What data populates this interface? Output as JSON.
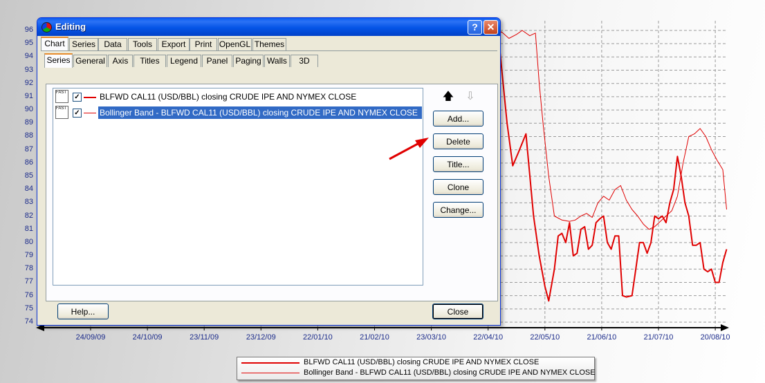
{
  "dialog": {
    "title": "Editing",
    "help_glyph": "?",
    "close_glyph": "✕",
    "main_tabs": [
      "Chart",
      "Series",
      "Data",
      "Tools",
      "Export",
      "Print",
      "OpenGL",
      "Themes"
    ],
    "sub_tabs": [
      "Series",
      "General",
      "Axis",
      "Titles",
      "Legend",
      "Panel",
      "Paging",
      "Walls",
      "3D"
    ],
    "series_items": [
      {
        "label": "BLFWD CAL11 (USD/BBL) closing CRUDE IPE AND NYMEX CLOSE",
        "checked": true,
        "selected": false
      },
      {
        "label": "Bollinger Band - BLFWD CAL11 (USD/BBL) closing CRUDE IPE AND NYMEX CLOSE",
        "checked": true,
        "selected": true
      }
    ],
    "fast_icon_text": "FAST",
    "check_glyph": "✓",
    "move_up_glyph": "🡅",
    "move_down_glyph": "⇩",
    "buttons": {
      "add": "Add...",
      "delete": "Delete",
      "title": "Title...",
      "clone": "Clone",
      "change": "Change..."
    },
    "help_button": "Help...",
    "close_button": "Close"
  },
  "colors": {
    "series": "#e00000",
    "axis_labels": "#1a2a8a",
    "titlebar": "#0554e6",
    "selection": "#316ac5"
  },
  "chart_data": {
    "type": "line",
    "ylim": [
      74,
      96
    ],
    "yticks": [
      96,
      95,
      94,
      93,
      92,
      91,
      90,
      89,
      88,
      87,
      86,
      85,
      84,
      83,
      82,
      81,
      80,
      79,
      78,
      77,
      76,
      75,
      74
    ],
    "xticks": [
      "24/09/09",
      "24/10/09",
      "23/11/09",
      "23/12/09",
      "22/01/10",
      "21/02/10",
      "23/03/10",
      "22/04/10",
      "22/05/10",
      "21/06/10",
      "21/07/10",
      "20/08/10"
    ],
    "grid": true,
    "legend": "bottom",
    "series": [
      {
        "name": "BLFWD CAL11 (USD/BBL) closing CRUDE IPE AND NYMEX CLOSE",
        "x": [
          "22/04/10",
          "25/04/10",
          "28/04/10",
          "02/05/10",
          "05/05/10",
          "08/05/10",
          "12/05/10",
          "16/05/10",
          "19/05/10",
          "22/05/10",
          "24/05/10",
          "27/05/10",
          "29/05/10",
          "31/05/10",
          "02/06/10",
          "04/06/10",
          "06/06/10",
          "08/06/10",
          "10/06/10",
          "12/06/10",
          "14/06/10",
          "16/06/10",
          "18/06/10",
          "20/06/10",
          "22/06/10",
          "24/06/10",
          "26/06/10",
          "28/06/10",
          "30/06/10",
          "02/07/10",
          "04/07/10",
          "07/07/10",
          "09/07/10",
          "11/07/10",
          "13/07/10",
          "15/07/10",
          "17/07/10",
          "19/07/10",
          "21/07/10",
          "23/07/10",
          "25/07/10",
          "27/07/10",
          "29/07/10",
          "31/07/10",
          "02/08/10",
          "04/08/10",
          "06/08/10",
          "08/08/10",
          "10/08/10",
          "12/08/10",
          "14/08/10",
          "16/08/10",
          "18/08/10",
          "20/08/10",
          "22/08/10",
          "24/08/10",
          "26/08/10"
        ],
        "y": [
          92.0,
          93.5,
          94.8,
          89.0,
          85.8,
          86.8,
          88.2,
          82.0,
          79.0,
          76.7,
          75.6,
          78.0,
          80.5,
          80.7,
          80.0,
          81.5,
          79.0,
          79.2,
          81.0,
          81.2,
          79.5,
          79.8,
          81.5,
          81.8,
          82.0,
          80.0,
          79.5,
          80.5,
          80.5,
          76.0,
          75.9,
          76.0,
          78.0,
          80.0,
          80.0,
          79.2,
          80.0,
          82.0,
          81.8,
          82.0,
          81.5,
          83.0,
          84.0,
          86.5,
          85.0,
          83.0,
          82.0,
          79.8,
          79.8,
          80.0,
          78.0,
          77.8,
          78.0,
          77.0,
          77.0,
          78.5,
          79.5
        ]
      },
      {
        "name": "Bollinger Band - BLFWD CAL11 (USD/BBL) closing CRUDE IPE AND NYMEX CLOSE",
        "x": [
          "22/04/10",
          "24/04/10",
          "26/04/10",
          "29/04/10",
          "03/05/10",
          "07/05/10",
          "10/05/10",
          "14/05/10",
          "17/05/10",
          "19/05/10",
          "21/05/10",
          "24/05/10",
          "27/05/10",
          "31/05/10",
          "04/06/10",
          "07/06/10",
          "10/06/10",
          "13/06/10",
          "16/06/10",
          "19/06/10",
          "22/06/10",
          "25/06/10",
          "28/06/10",
          "01/07/10",
          "04/07/10",
          "07/07/10",
          "10/07/10",
          "13/07/10",
          "16/07/10",
          "19/07/10",
          "22/07/10",
          "25/07/10",
          "28/07/10",
          "31/07/10",
          "03/08/10",
          "06/08/10",
          "09/08/10",
          "12/08/10",
          "15/08/10",
          "18/08/10",
          "21/08/10",
          "24/08/10",
          "26/08/10"
        ],
        "y": [
          92.0,
          95.0,
          95.3,
          95.9,
          95.4,
          95.7,
          96.0,
          95.6,
          95.8,
          92.0,
          89.0,
          85.0,
          82.0,
          81.7,
          81.6,
          81.7,
          82.0,
          82.2,
          81.9,
          83.0,
          83.5,
          83.2,
          84.0,
          84.3,
          83.2,
          82.5,
          82.0,
          81.4,
          81.0,
          81.2,
          81.6,
          82.0,
          82.4,
          83.5,
          86.0,
          88.0,
          88.2,
          88.6,
          88.0,
          87.0,
          86.2,
          85.5,
          82.5
        ]
      }
    ]
  }
}
